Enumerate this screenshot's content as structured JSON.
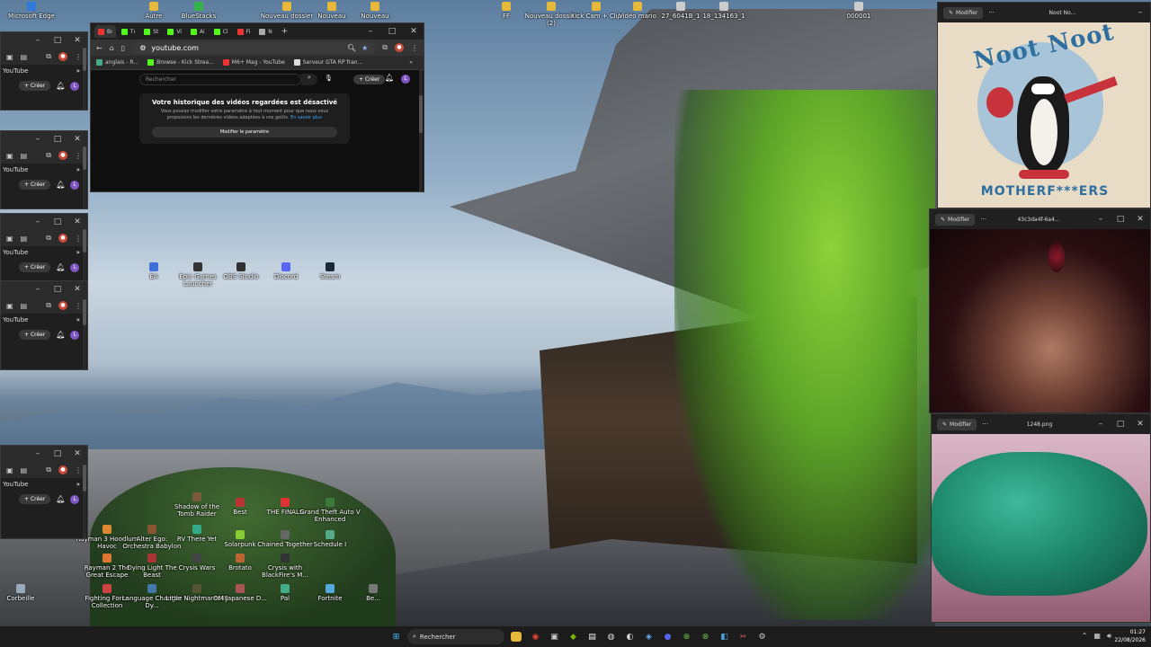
{
  "desktop_icons_top": [
    {
      "label": "Microsoft Edge",
      "color": "#2f7ad8"
    },
    {
      "label": "Autre",
      "color": "#e7b93a"
    },
    {
      "label": "BlueStacks",
      "color": "#34b34a"
    },
    {
      "label": "Nouveau dossier",
      "color": "#e7b93a"
    },
    {
      "label": "Nouveau",
      "color": "#e7b93a"
    },
    {
      "label": "Nouveau",
      "color": "#e7b93a"
    },
    {
      "label": "FF",
      "color": "#e7b93a"
    },
    {
      "label": "Nouveau dossier (2)",
      "color": "#e7b93a"
    },
    {
      "label": "Kick Cam + Clip",
      "color": "#e7b93a"
    },
    {
      "label": "Vidéo mario",
      "color": "#e7b93a"
    },
    {
      "label": "27_6041B_1",
      "color": "#cccccc"
    },
    {
      "label": "18_134163_1",
      "color": "#cccccc"
    },
    {
      "label": "000001",
      "color": "#cccccc"
    }
  ],
  "desktop_icons_mid": [
    {
      "label": "EA",
      "color": "#3f6fd8"
    },
    {
      "label": "Epic Games Launcher",
      "color": "#333333"
    },
    {
      "label": "OBS Studio",
      "color": "#302e31"
    },
    {
      "label": "Discord",
      "color": "#5865f2"
    },
    {
      "label": "Steam",
      "color": "#1b2838"
    }
  ],
  "desktop_icons_games": [
    {
      "label": "Shadow of the Tomb Raider",
      "color": "#7a5a3a"
    },
    {
      "label": "Best",
      "color": "#b33"
    },
    {
      "label": "THE FINALS",
      "color": "#d33"
    },
    {
      "label": "Grand Theft Auto V Enhanced",
      "color": "#3a7a3a"
    },
    {
      "label": "Rayman 3 Hoodlum Havoc",
      "color": "#d83"
    },
    {
      "label": "Alter Ego: Orchestra Babylon",
      "color": "#853"
    },
    {
      "label": "RV There Yet",
      "color": "#3a8"
    },
    {
      "label": "Solarpunk",
      "color": "#8c3"
    },
    {
      "label": "Chained Together",
      "color": "#666"
    },
    {
      "label": "Schedule I",
      "color": "#5a8"
    },
    {
      "label": "Rayman 2 The Great Escape",
      "color": "#d73"
    },
    {
      "label": "Dying Light The Beast",
      "color": "#a33"
    },
    {
      "label": "Crysis Wars",
      "color": "#444"
    },
    {
      "label": "Brotato",
      "color": "#b63"
    },
    {
      "label": "Crysis with BlackFire's M...",
      "color": "#333"
    },
    {
      "label": "Corbeille",
      "color": "#9ab"
    },
    {
      "label": "Fighting Force Collection",
      "color": "#c44"
    },
    {
      "label": "Language Changer Dy...",
      "color": "#47a"
    },
    {
      "label": "Little Nightmares III",
      "color": "#553"
    },
    {
      "label": "OM Japanese D...",
      "color": "#a55"
    },
    {
      "label": "Pal",
      "color": "#4a8"
    },
    {
      "label": "Fortnite",
      "color": "#5ad"
    },
    {
      "label": "Be...",
      "color": "#777"
    }
  ],
  "small_windows": [
    {
      "yt_label": "YouTube",
      "create": "Créer",
      "avatar": "L"
    },
    {
      "yt_label": "YouTube",
      "create": "Créer",
      "avatar": "L"
    },
    {
      "yt_label": "YouTube",
      "create": "Créer",
      "avatar": "L"
    },
    {
      "yt_label": "YouTube",
      "create": "Créer",
      "avatar": "L"
    },
    {
      "yt_label": "YouTube",
      "create": "Créer",
      "avatar": "L"
    }
  ],
  "browser": {
    "tabs": [
      {
        "label": "Bı",
        "color": "#e33"
      },
      {
        "label": "Tı",
        "color": "#53fc18"
      },
      {
        "label": "St",
        "color": "#53fc18"
      },
      {
        "label": "Vi",
        "color": "#53fc18"
      },
      {
        "label": "Ai",
        "color": "#53fc18"
      },
      {
        "label": "Cl",
        "color": "#53fc18"
      },
      {
        "label": "Fi",
        "color": "#e33"
      },
      {
        "label": "N",
        "color": "#aaa"
      }
    ],
    "address": "youtube.com",
    "bookmarks": [
      {
        "label": "anglais - R...",
        "color": "#4a8"
      },
      {
        "label": "Browse - Kick Strea...",
        "color": "#53fc18"
      },
      {
        "label": "M6+ Mag - YouTube",
        "color": "#e33"
      },
      {
        "label": "Serveur GTA RP fran...",
        "color": "#ddd"
      }
    ],
    "search_placeholder": "Rechercher",
    "create_label": "Créer",
    "avatar": "L",
    "history_title": "Votre historique des vidéos regardées est désactivé",
    "history_desc": "Vous pouvez modifier votre paramètre à tout moment pour que nous vous proposions les dernières vidéos adaptées à vos goûts.",
    "history_link": "En savoir plus",
    "history_button": "Modifier le paramètre"
  },
  "viewers": [
    {
      "edit": "Modifier",
      "title": "Noot No..."
    },
    {
      "edit": "Modifier",
      "title": "43c3da4f-6a4..."
    },
    {
      "edit": "Modifier",
      "title": "1248.png"
    }
  ],
  "noot_text": {
    "top": "Noot Noot",
    "bottom": "MOTHERF***ERS"
  },
  "taskbar": {
    "search": "Rechercher",
    "time": "01:27",
    "date": "22/08/2026"
  }
}
